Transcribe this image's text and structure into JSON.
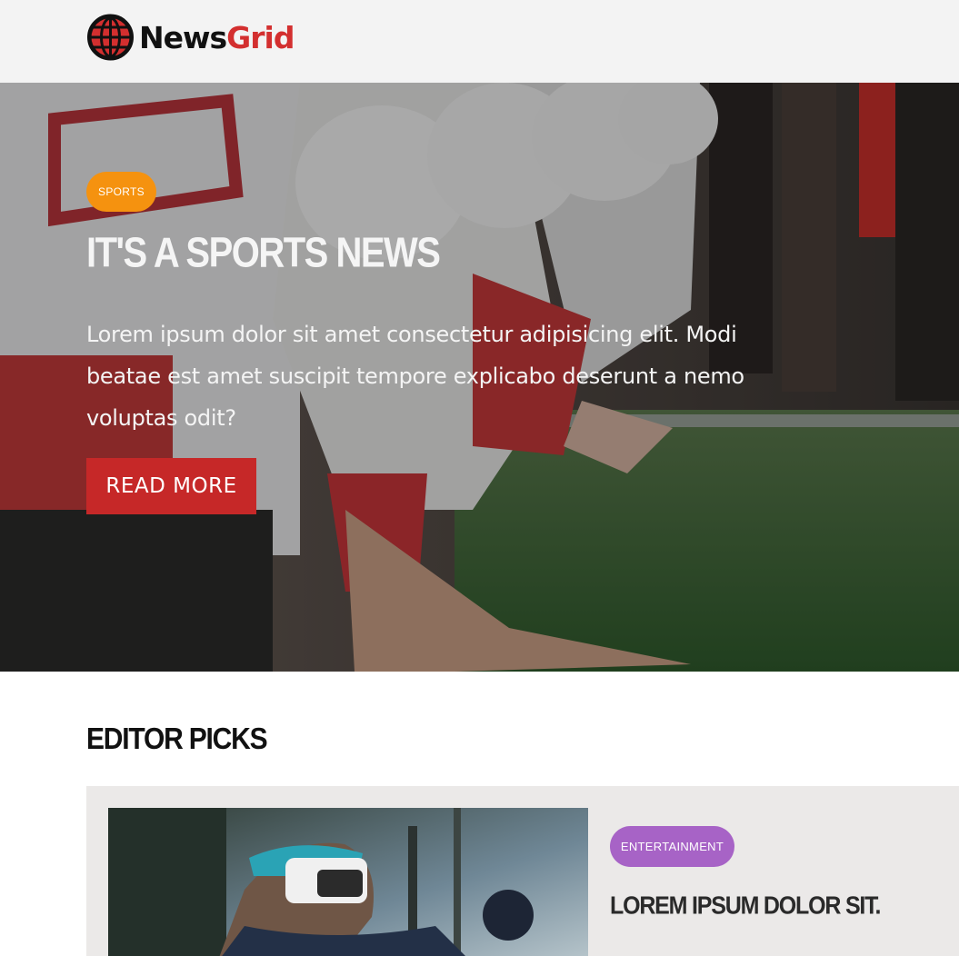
{
  "header": {
    "logo_text_part1": "News",
    "logo_text_part2": "Grid",
    "logo_icon": "globe-icon"
  },
  "hero": {
    "category": "SPORTS",
    "title": "IT'S A SPORTS NEWS",
    "text": "Lorem ipsum dolor sit amet consectetur adipisicing elit. Modi beatae est amet suscipit tempore explicabo deserunt a nemo voluptas odit?",
    "button_label": "READ MORE"
  },
  "editor_picks": {
    "heading": "EDITOR PICKS",
    "card": {
      "category": "ENTERTAINMENT",
      "title": "LOREM IPSUM DOLOR SIT."
    }
  },
  "colors": {
    "brand_red": "#d32f2f",
    "button_red": "#c62828",
    "sports_badge": "#f5920f",
    "entertainment_badge": "#a763c6",
    "header_bg": "#f3f3f3",
    "card_bg": "#ebe9e8"
  }
}
